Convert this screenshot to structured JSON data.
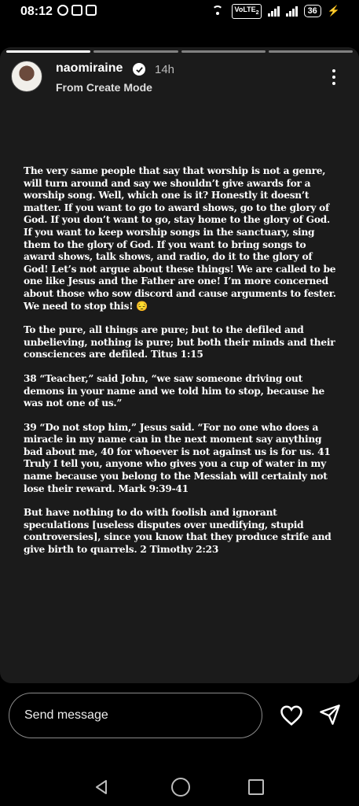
{
  "status_bar": {
    "time": "08:12",
    "network_badge": "VoLTE",
    "network_sub": "2",
    "battery": "36"
  },
  "story": {
    "progress_segments": 4,
    "progress_active_index": 0,
    "username": "naomiraine",
    "verified": true,
    "time_ago": "14h",
    "subtitle": "From Create Mode",
    "paragraphs": [
      "The very same people that say that worship is not a genre, will turn around and say we shouldn’t give awards for a worship song. Well, which one is it? Honestly it doesn’t matter. If you want to go to award shows, go to the glory of God. If you don’t want to go, stay home to the glory of God. If you want to keep worship songs in the sanctuary, sing them to the glory of God. If you want to bring songs to award shows, talk shows, and radio, do it to the glory of God! Let’s not argue about these things! We are called to be one like Jesus and the Father are one! I’m more concerned about those who sow discord and cause arguments to fester. We need to stop this! 😔",
      "To the pure, all things are pure; but to the defiled and unbelieving, nothing is pure; but both their minds and their consciences are defiled. Titus 1:15",
      "38 “Teacher,” said John, “we saw someone driving out demons in your name and we told him to stop, because he was not one of us.”",
      "39 “Do not stop him,” Jesus said. “For no one who does a miracle in my name can in the next moment say anything bad about me, 40 for whoever is not against us is for us. 41 Truly I tell you, anyone who gives you a cup of water in my name because you belong to the Messiah will certainly not lose their reward. Mark 9:39-41",
      "But have nothing to do with foolish and ignorant speculations [useless disputes over unedifying, stupid controversies], since you know that they produce strife and give birth to quarrels. 2 Timothy 2:23"
    ]
  },
  "message_bar": {
    "placeholder": "Send message",
    "like_icon": "heart-icon",
    "send_icon": "send-icon"
  },
  "nav_bar": {
    "icons": [
      "back-icon",
      "home-icon",
      "recents-icon"
    ]
  }
}
